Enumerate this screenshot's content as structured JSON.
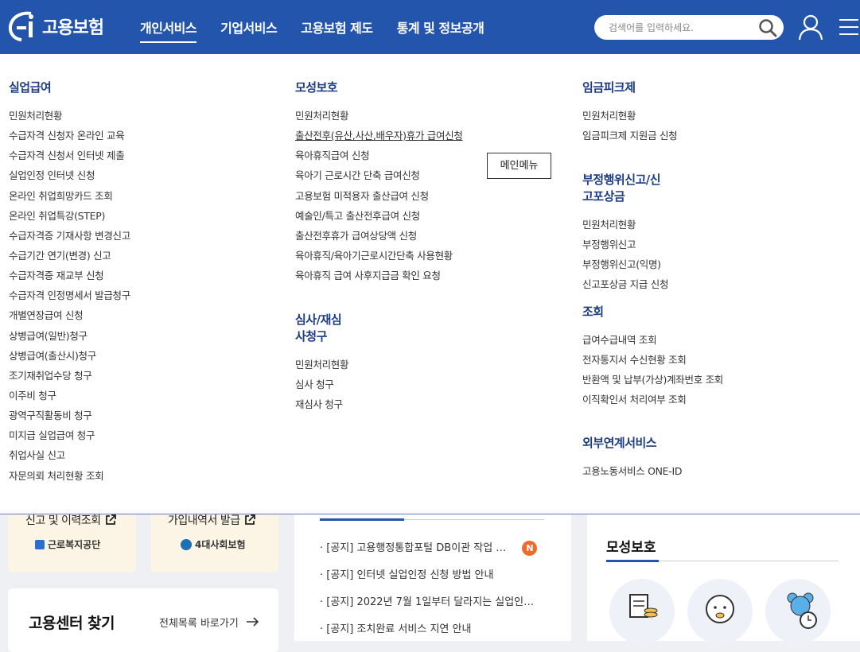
{
  "header": {
    "logo_text": "고용보험",
    "nav": [
      "개인서비스",
      "기업서비스",
      "고용보험 제도",
      "통계 및 정보공개"
    ],
    "active_nav": 0,
    "search_placeholder": "검색어를 입력하세요.",
    "brand_color": "#2355ac"
  },
  "mega_menu": {
    "col1": {
      "title": "실업급여",
      "items": [
        "민원처리현황",
        "수급자격 신청자 온라인 교육",
        "수급자격 신청서 인터넷 제출",
        "실업인정 인터넷 신청",
        "온라인 취업희망카드 조회",
        "온라인 취업특강(STEP)",
        "수급자격증 기재사항 변경신고",
        "수급기간 연기(변경) 신고",
        "수급자격증 재교부 신청",
        "수급자격 인정명세서 발급청구",
        "개별연장급여 신청",
        "상병급여(일반)청구",
        "상병급여(출산시)청구",
        "조기재취업수당 청구",
        "이주비 청구",
        "광역구직활동비 청구",
        "미지급 실업급여 청구",
        "취업사실 신고",
        "자문의뢰 처리현황 조회"
      ]
    },
    "col2": {
      "sections": [
        {
          "title": "모성보호",
          "items": [
            "민원처리현황",
            "출산전후(유산,사산,배우자)휴가 급여신청",
            "육아휴직급여 신청",
            "육아기 근로시간 단축 급여신청",
            "고용보험 미적용자 출산급여 신청",
            "예술인/특고 출산전후급여 신청",
            "출산전후휴가 급여상당액 신청",
            "육아휴직/육아기근로시간단축 사용현황",
            "육아휴직 급여 사후지급금 확인 요청"
          ]
        },
        {
          "title": "심사/재심사청구",
          "items": [
            "민원처리현황",
            "심사 청구",
            "재심사 청구"
          ]
        }
      ]
    },
    "col3": {
      "sections": [
        {
          "title": "임금피크제",
          "items": [
            "민원처리현황",
            "임금피크제 지원금 신청"
          ]
        },
        {
          "title": "부정행위신고/신고포상금",
          "items": [
            "민원처리현황",
            "부정행위신고",
            "부정행위신고(익명)",
            "신고포상금 지급 신청"
          ]
        },
        {
          "title": "조회",
          "items": [
            "급여수급내역 조회",
            "전자통지서 수신현황 조회",
            "반환액 및 납부(가상)계좌번호 조회",
            "이직확인서 처리여부 조회"
          ]
        },
        {
          "title": "외부연계서비스",
          "items": [
            "고용노동서비스 ONE-ID"
          ]
        }
      ]
    },
    "tooltip": "메인메뉴"
  },
  "lower": {
    "card1_text": "신고 및 이력조회",
    "card1_org": "근로복지공단",
    "card2_text": "가입내역서 발급",
    "card2_org": "4대사회보험",
    "center_title": "고용센터 찾기",
    "center_link": "전체목록 바로가기",
    "notices": [
      "[공지] 고용행정통합포털 DB이관 작업 …",
      "[공지] 인터넷 실업인정 신청 방법 안내",
      "[공지] 2022년 7월 1일부터 달라지는 실업인…",
      "[공지] 조치완료 서비스 지연 안내"
    ],
    "notice_badge": "N",
    "right_title": "모성보호"
  }
}
